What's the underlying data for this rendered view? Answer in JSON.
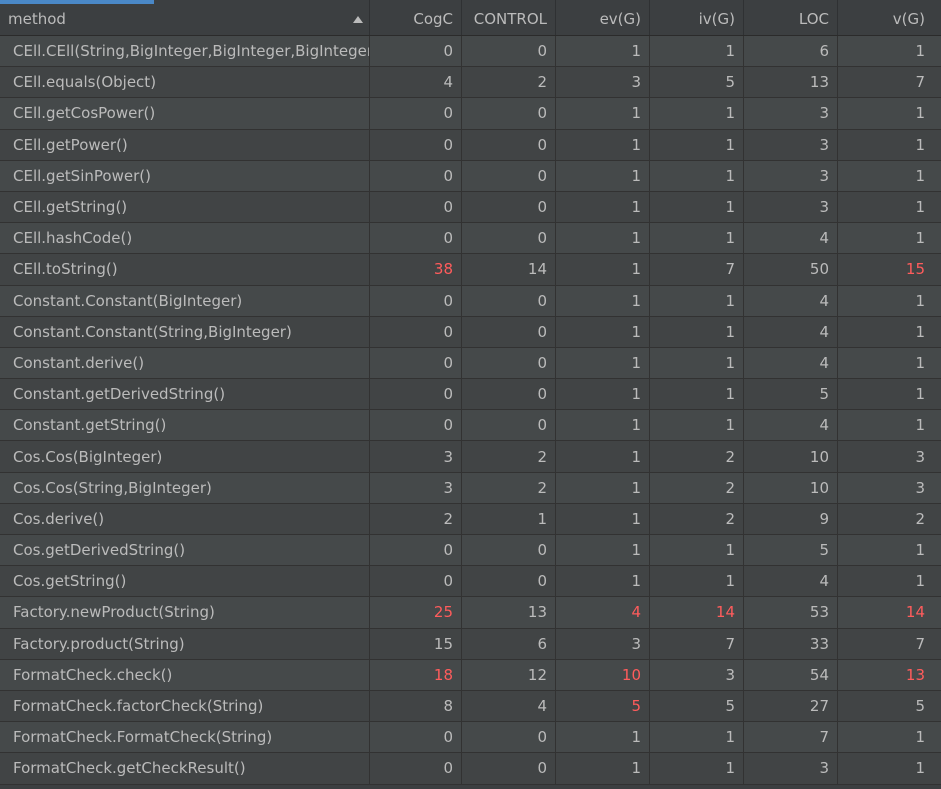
{
  "columns": [
    "method",
    "CogC",
    "CONTROL",
    "ev(G)",
    "iv(G)",
    "LOC",
    "v(G)"
  ],
  "sort_icon": "sort-ascending-icon",
  "highlight_color": "#ff5c5c",
  "rows": [
    {
      "method": "CEll.CEll(String,BigInteger,BigInteger,BigInteger)",
      "cogc": "0",
      "control": "0",
      "evg": "1",
      "ivg": "1",
      "loc": "6",
      "vg": "1"
    },
    {
      "method": "CEll.equals(Object)",
      "cogc": "4",
      "control": "2",
      "evg": "3",
      "ivg": "5",
      "loc": "13",
      "vg": "7"
    },
    {
      "method": "CEll.getCosPower()",
      "cogc": "0",
      "control": "0",
      "evg": "1",
      "ivg": "1",
      "loc": "3",
      "vg": "1"
    },
    {
      "method": "CEll.getPower()",
      "cogc": "0",
      "control": "0",
      "evg": "1",
      "ivg": "1",
      "loc": "3",
      "vg": "1"
    },
    {
      "method": "CEll.getSinPower()",
      "cogc": "0",
      "control": "0",
      "evg": "1",
      "ivg": "1",
      "loc": "3",
      "vg": "1"
    },
    {
      "method": "CEll.getString()",
      "cogc": "0",
      "control": "0",
      "evg": "1",
      "ivg": "1",
      "loc": "3",
      "vg": "1"
    },
    {
      "method": "CEll.hashCode()",
      "cogc": "0",
      "control": "0",
      "evg": "1",
      "ivg": "1",
      "loc": "4",
      "vg": "1"
    },
    {
      "method": "CEll.toString()",
      "cogc": "38",
      "control": "14",
      "evg": "1",
      "ivg": "7",
      "loc": "50",
      "vg": "15",
      "highlight": [
        "cogc",
        "vg"
      ]
    },
    {
      "method": "Constant.Constant(BigInteger)",
      "cogc": "0",
      "control": "0",
      "evg": "1",
      "ivg": "1",
      "loc": "4",
      "vg": "1"
    },
    {
      "method": "Constant.Constant(String,BigInteger)",
      "cogc": "0",
      "control": "0",
      "evg": "1",
      "ivg": "1",
      "loc": "4",
      "vg": "1"
    },
    {
      "method": "Constant.derive()",
      "cogc": "0",
      "control": "0",
      "evg": "1",
      "ivg": "1",
      "loc": "4",
      "vg": "1"
    },
    {
      "method": "Constant.getDerivedString()",
      "cogc": "0",
      "control": "0",
      "evg": "1",
      "ivg": "1",
      "loc": "5",
      "vg": "1"
    },
    {
      "method": "Constant.getString()",
      "cogc": "0",
      "control": "0",
      "evg": "1",
      "ivg": "1",
      "loc": "4",
      "vg": "1"
    },
    {
      "method": "Cos.Cos(BigInteger)",
      "cogc": "3",
      "control": "2",
      "evg": "1",
      "ivg": "2",
      "loc": "10",
      "vg": "3"
    },
    {
      "method": "Cos.Cos(String,BigInteger)",
      "cogc": "3",
      "control": "2",
      "evg": "1",
      "ivg": "2",
      "loc": "10",
      "vg": "3"
    },
    {
      "method": "Cos.derive()",
      "cogc": "2",
      "control": "1",
      "evg": "1",
      "ivg": "2",
      "loc": "9",
      "vg": "2"
    },
    {
      "method": "Cos.getDerivedString()",
      "cogc": "0",
      "control": "0",
      "evg": "1",
      "ivg": "1",
      "loc": "5",
      "vg": "1"
    },
    {
      "method": "Cos.getString()",
      "cogc": "0",
      "control": "0",
      "evg": "1",
      "ivg": "1",
      "loc": "4",
      "vg": "1"
    },
    {
      "method": "Factory.newProduct(String)",
      "cogc": "25",
      "control": "13",
      "evg": "4",
      "ivg": "14",
      "loc": "53",
      "vg": "14",
      "highlight": [
        "cogc",
        "evg",
        "ivg",
        "vg"
      ]
    },
    {
      "method": "Factory.product(String)",
      "cogc": "15",
      "control": "6",
      "evg": "3",
      "ivg": "7",
      "loc": "33",
      "vg": "7"
    },
    {
      "method": "FormatCheck.check()",
      "cogc": "18",
      "control": "12",
      "evg": "10",
      "ivg": "3",
      "loc": "54",
      "vg": "13",
      "highlight": [
        "cogc",
        "evg",
        "vg"
      ]
    },
    {
      "method": "FormatCheck.factorCheck(String)",
      "cogc": "8",
      "control": "4",
      "evg": "5",
      "ivg": "5",
      "loc": "27",
      "vg": "5",
      "highlight": [
        "evg"
      ]
    },
    {
      "method": "FormatCheck.FormatCheck(String)",
      "cogc": "0",
      "control": "0",
      "evg": "1",
      "ivg": "1",
      "loc": "7",
      "vg": "1"
    },
    {
      "method": "FormatCheck.getCheckResult()",
      "cogc": "0",
      "control": "0",
      "evg": "1",
      "ivg": "1",
      "loc": "3",
      "vg": "1"
    }
  ]
}
